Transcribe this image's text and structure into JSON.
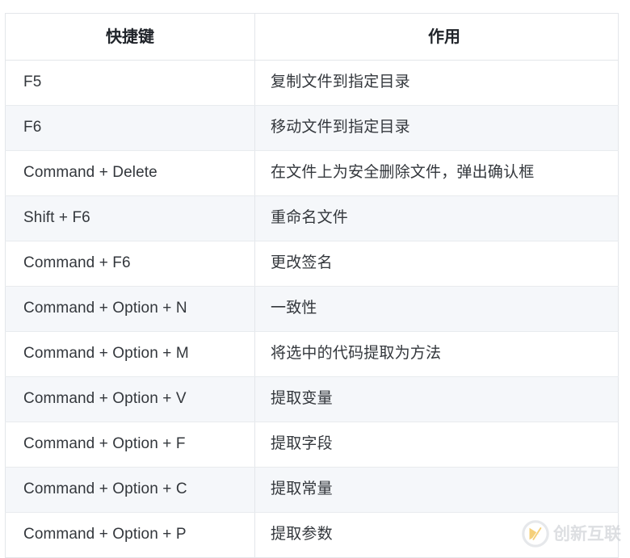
{
  "table": {
    "headers": [
      "快捷键",
      "作用"
    ],
    "rows": [
      {
        "key": "F5",
        "desc": "复制文件到指定目录"
      },
      {
        "key": "F6",
        "desc": "移动文件到指定目录"
      },
      {
        "key": "Command + Delete",
        "desc": "在文件上为安全删除文件，弹出确认框"
      },
      {
        "key": "Shift + F6",
        "desc": "重命名文件"
      },
      {
        "key": "Command + F6",
        "desc": "更改签名"
      },
      {
        "key": "Command + Option + N",
        "desc": "一致性"
      },
      {
        "key": "Command + Option + M",
        "desc": "将选中的代码提取为方法"
      },
      {
        "key": "Command + Option + V",
        "desc": "提取变量"
      },
      {
        "key": "Command + Option + F",
        "desc": "提取字段"
      },
      {
        "key": "Command + Option + C",
        "desc": "提取常量"
      },
      {
        "key": "Command + Option + P",
        "desc": "提取参数"
      }
    ]
  },
  "watermark": {
    "text": "创新互联",
    "logo_icon": "circle-x-logo-icon",
    "logo_accent_color": "#f0b429",
    "text_color": "#c9ccd1"
  },
  "colors": {
    "border": "#e3e6ea",
    "row_stripe": "#f5f7fa",
    "row_plain": "#ffffff",
    "text": "#33373c",
    "header_text": "#20242a"
  }
}
